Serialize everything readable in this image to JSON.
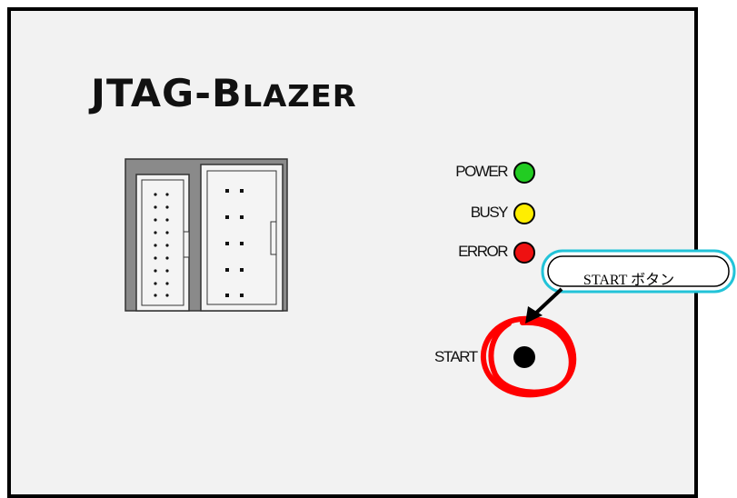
{
  "title": {
    "main": "JTAG-B",
    "rest": "LAZER"
  },
  "leds": [
    {
      "label": "POWER",
      "color": "#22cc22"
    },
    {
      "label": "BUSY",
      "color": "#ffee00"
    },
    {
      "label": "ERROR",
      "color": "#ee1111"
    }
  ],
  "start": {
    "label": "START",
    "button_color": "#000000",
    "highlight_color": "#ff0000"
  },
  "callout": {
    "text": "START ボタン",
    "border_color": "#22c3d8"
  },
  "connector": {
    "body_color": "#8a8a8a",
    "housing_color": "#f4f4f4"
  }
}
